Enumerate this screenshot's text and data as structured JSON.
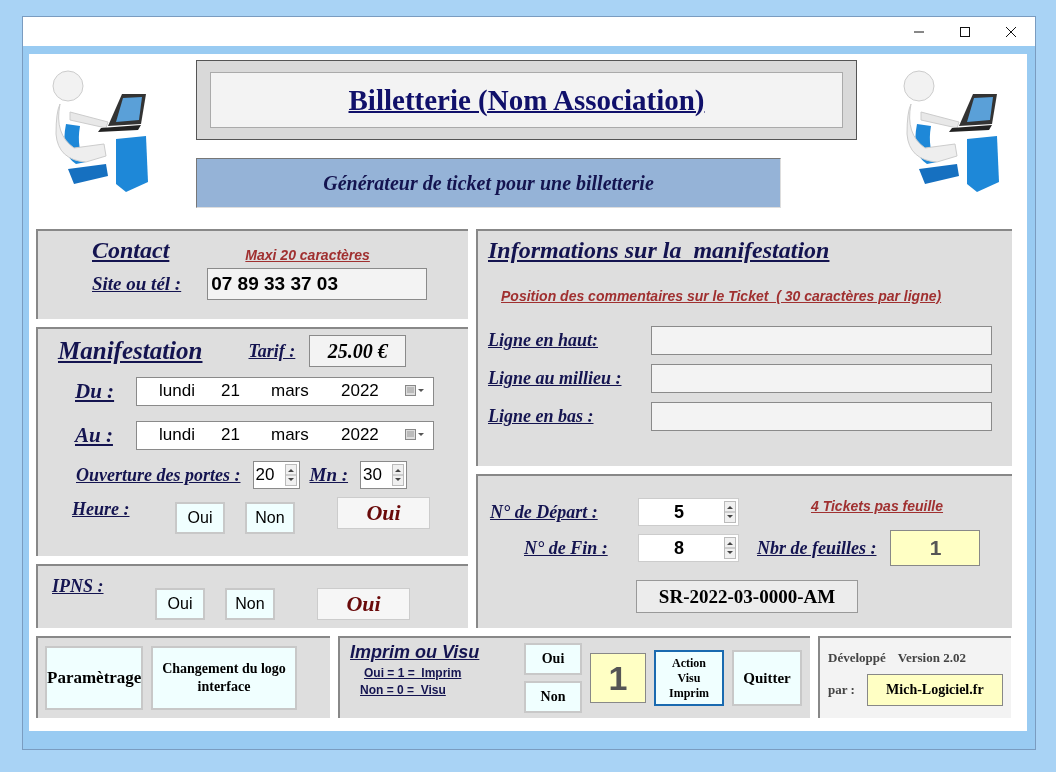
{
  "header": {
    "title": "Billetterie (Nom Association)",
    "subtitle": "Générateur de ticket pour une billetterie"
  },
  "contact": {
    "heading": "Contact",
    "hint": "Maxi 20 caractères",
    "label": "Site ou tél :",
    "value": "07 89 33 37 03"
  },
  "manifestation": {
    "heading": "Manifestation",
    "tarif_label": "Tarif :",
    "tarif": "25.00 €",
    "dates": [
      {
        "label": "Du :",
        "parts": [
          "lundi",
          "21",
          "mars",
          "2022"
        ]
      },
      {
        "label": "Au :",
        "parts": [
          "lundi",
          "21",
          "mars",
          "2022"
        ]
      }
    ],
    "doors_label": "Ouverture des portes :",
    "hour": "20",
    "minutes_label": "Mn :",
    "minutes": "30",
    "heure_label": "Heure :",
    "buttons": [
      "Oui",
      "Non"
    ],
    "result": "Oui"
  },
  "ipns": {
    "label": "IPNS :",
    "buttons": [
      "Oui",
      "Non"
    ],
    "result": "Oui"
  },
  "info": {
    "heading": "Informations sur la  manifestation",
    "hint": "Position des commentaires sur le Ticket  ( 30 caractères par ligne)",
    "lines": [
      {
        "label": "Ligne en haut:"
      },
      {
        "label": "Ligne au millieu :"
      },
      {
        "label": "Ligne en bas :"
      }
    ]
  },
  "tickets": {
    "start_label": "N° de Départ :",
    "start": "5",
    "end_label": "N° de Fin :",
    "end": "8",
    "per_sheet": "4 Tickets pas feuille",
    "sheets_label": "Nbr de feuilles :",
    "sheets": "1",
    "reference": "SR-2022-03-0000-AM"
  },
  "footer": {
    "buttons": [
      "Paramètrage",
      "Changement du logo interface"
    ],
    "print": {
      "heading": "Imprim ou Visu",
      "legend": [
        "Oui = 1 =  Imprim",
        "Non = 0 =  Visu"
      ],
      "buttons": [
        "Oui",
        "Non"
      ],
      "value": "1",
      "action": "Action Visu Imprim",
      "quit": "Quitter"
    },
    "credits": {
      "developed": "Développé",
      "version": "Version 2.02",
      "by": "par :",
      "author": "Mich-Logiciel.fr"
    }
  }
}
